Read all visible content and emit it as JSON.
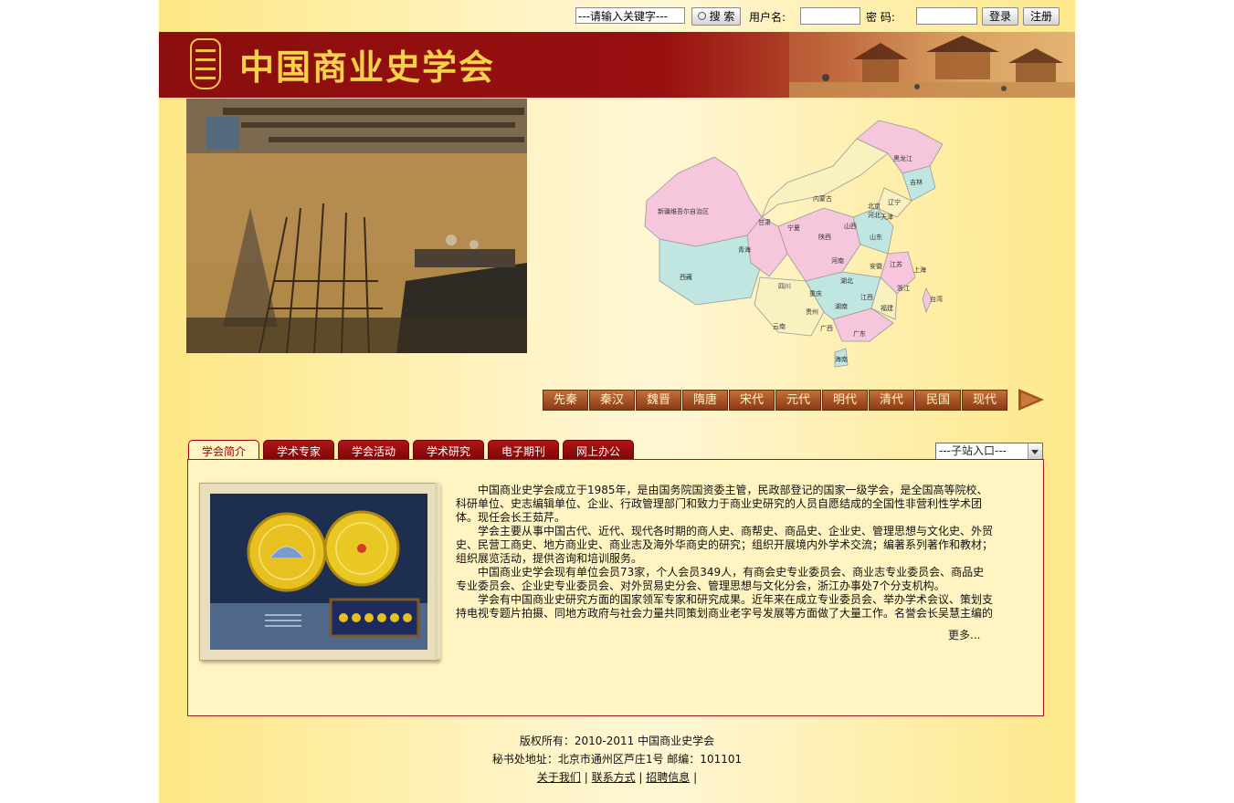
{
  "topbar": {
    "search_placeholder": "---请输入关键字---",
    "search_button": "搜 索",
    "username_label": "用户名:",
    "password_label": "密 码:",
    "login_button": "登录",
    "register_button": "注册"
  },
  "banner": {
    "title": "中国商业史学会"
  },
  "map": {
    "provinces": [
      "黑龙江",
      "吉林",
      "辽宁",
      "内蒙古",
      "新疆维吾尔自治区",
      "西藏",
      "青海",
      "甘肃",
      "宁夏",
      "陕西",
      "山西",
      "河北",
      "北京",
      "天津",
      "山东",
      "河南",
      "江苏",
      "安徽",
      "上海",
      "湖北",
      "四川",
      "重庆",
      "浙江",
      "江西",
      "湖南",
      "贵州",
      "云南",
      "福建",
      "广西",
      "广东",
      "台湾",
      "海南"
    ]
  },
  "dynasties": [
    "先秦",
    "秦汉",
    "魏晋",
    "隋唐",
    "宋代",
    "元代",
    "明代",
    "清代",
    "民国",
    "现代"
  ],
  "tabs": [
    "学会简介",
    "学术专家",
    "学会活动",
    "学术研究",
    "电子期刊",
    "网上办公"
  ],
  "subsite_select": "---子站入口---",
  "intro": {
    "paragraphs": [
      "中国商业史学会成立于1985年，是由国务院国资委主管，民政部登记的国家一级学会，是全国高等院校、科研单位、史志编辑单位、企业、行政管理部门和致力于商业史研究的人员自愿结成的全国性非营利性学术团体。现任会长王茹芹。",
      "学会主要从事中国古代、近代、现代各时期的商人史、商帮史、商品史、企业史、管理思想与文化史、外贸史、民营工商史、地方商业史、商业志及海外华商史的研究；组织开展境内外学术交流；编著系列著作和教材；组织展览活动，提供咨询和培训服务。",
      "中国商业史学会现有单位会员73家，个人会员349人，有商会史专业委员会、商业志专业委员会、商品史专业委员会、企业史专业委员会、对外贸易史分会、管理思想与文化分会，浙江办事处7个分支机构。",
      "学会有中国商业史研究方面的国家领军专家和研究成果。近年来在成立专业委员会、举办学术会议、策划支持电视专题片拍摄、同地方政府与社会力量共同策划商业老字号发展等方面做了大量工作。名誉会长吴慧主编的"
    ],
    "more": "更多..."
  },
  "footer": {
    "copyright": "版权所有：2010-2011 中国商业史学会",
    "address": "秘书处地址：北京市通州区芦庄1号 邮编：101101",
    "links": [
      "关于我们",
      "联系方式",
      "招聘信息"
    ]
  }
}
